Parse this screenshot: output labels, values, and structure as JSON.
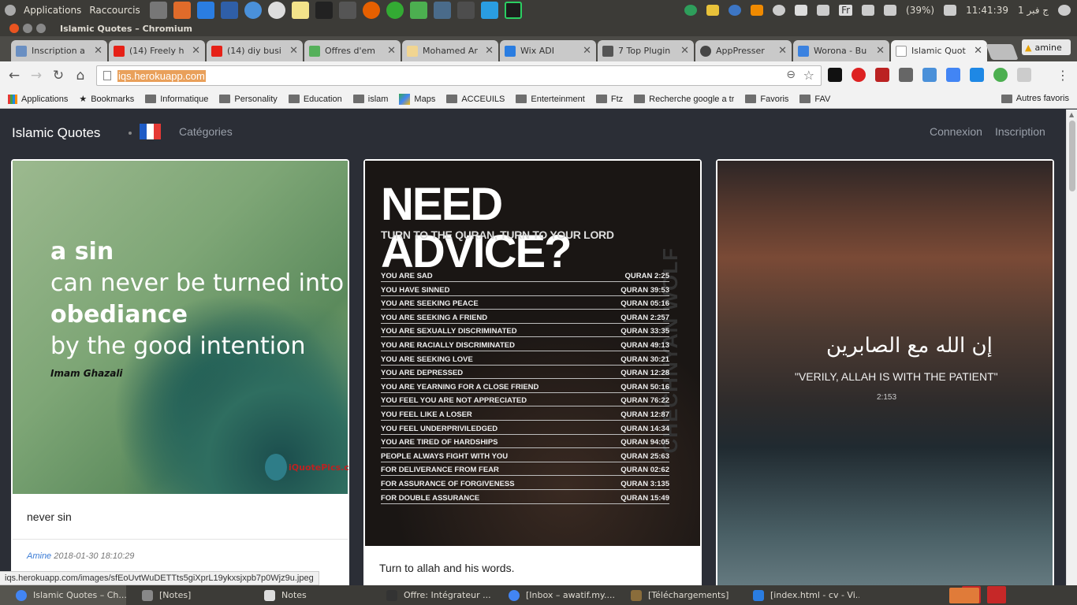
{
  "system_bar": {
    "menu_applications": "Applications",
    "menu_shortcuts": "Raccourcis",
    "battery": "(39%)",
    "clock": "11:41:39",
    "date_arabic": "ج فبر 1",
    "keyboard_layout": "Fr"
  },
  "window": {
    "title": "Islamic Quotes – Chromium"
  },
  "tabs": [
    {
      "label": "Inscription a",
      "fav_color": "#6a8fc2"
    },
    {
      "label": "(14) Freely h",
      "fav_color": "#e62117"
    },
    {
      "label": "(14) diy busi",
      "fav_color": "#e62117"
    },
    {
      "label": "Offres d'em",
      "fav_color": "#55b05a"
    },
    {
      "label": "Mohamed Ar",
      "fav_color": "#f1d591"
    },
    {
      "label": "Wix ADI",
      "fav_color": "#2a7de1"
    },
    {
      "label": "7 Top Plugin",
      "fav_color": "#555555"
    },
    {
      "label": "AppPresser",
      "fav_color": "#464646"
    },
    {
      "label": "Worona - Bu",
      "fav_color": "#3b82e0"
    },
    {
      "label": "Islamic Quot",
      "fav_color": "#ffffff",
      "active": true
    }
  ],
  "profile": {
    "name": "amine"
  },
  "address": {
    "url": "iqs.herokuapp.com"
  },
  "bookmarks": [
    {
      "label": "Applications",
      "icon": "apps-grid-icon"
    },
    {
      "label": "Bookmarks",
      "icon": "star-icon"
    },
    {
      "label": "Informatique",
      "icon": "folder-icon"
    },
    {
      "label": "Personality",
      "icon": "folder-icon"
    },
    {
      "label": "Education",
      "icon": "folder-icon"
    },
    {
      "label": "islam",
      "icon": "folder-icon"
    },
    {
      "label": "Maps",
      "icon": "maps-icon"
    },
    {
      "label": "ACCEUILS",
      "icon": "folder-icon"
    },
    {
      "label": "Enterteinment",
      "icon": "folder-icon"
    },
    {
      "label": "Ftz",
      "icon": "folder-icon"
    },
    {
      "label": "Recherche google a tr",
      "icon": "folder-icon"
    },
    {
      "label": "Favoris",
      "icon": "folder-icon"
    },
    {
      "label": "FAV",
      "icon": "folder-icon"
    }
  ],
  "bookmarks_other": "Autres favoris",
  "site": {
    "brand": "Islamic Quotes",
    "categories": "Catégories",
    "login": "Connexion",
    "signup": "Inscription"
  },
  "cards": [
    {
      "image_quote": {
        "line1": "a sin",
        "line2": "can never be turned into",
        "line3": "obediance",
        "line4": "by the good intention",
        "author": "Imam Ghazali",
        "watermark": "iQuotePics.com"
      },
      "title": "never sin",
      "meta_user": "Amine",
      "meta_date": "2018-01-30 18:10:29"
    },
    {
      "image_quote": {
        "heading": "NEED ADVICE?",
        "subheading": "TURN TO THE QURAN, TURN TO YOUR LORD",
        "side_text": "CHECHNYAN WOLF",
        "rows": [
          {
            "left": "YOU ARE SAD",
            "right": "QURAN 2:25"
          },
          {
            "left": "YOU HAVE SINNED",
            "right": "QURAN 39:53"
          },
          {
            "left": "YOU ARE SEEKING PEACE",
            "right": "QURAN 05:16"
          },
          {
            "left": "YOU ARE SEEKING A FRIEND",
            "right": "QURAN 2:257"
          },
          {
            "left": "YOU ARE SEXUALLY DISCRIMINATED",
            "right": "QURAN 33:35"
          },
          {
            "left": "YOU ARE RACIALLY DISCRIMINATED",
            "right": "QURAN 49:13"
          },
          {
            "left": "YOU ARE SEEKING LOVE",
            "right": "QURAN 30:21"
          },
          {
            "left": "YOU ARE DEPRESSED",
            "right": "QURAN 12:28"
          },
          {
            "left": "YOU ARE YEARNING FOR A CLOSE FRIEND",
            "right": "QURAN 50:16"
          },
          {
            "left": "YOU FEEL YOU ARE NOT APPRECIATED",
            "right": "QURAN 76:22"
          },
          {
            "left": "YOU FEEL LIKE A LOSER",
            "right": "QURAN 12:87"
          },
          {
            "left": "YOU FEEL UNDERPRIVILEDGED",
            "right": "QURAN 14:34"
          },
          {
            "left": "YOU ARE TIRED OF HARDSHIPS",
            "right": "QURAN 94:05"
          },
          {
            "left": "PEOPLE ALWAYS FIGHT WITH YOU",
            "right": "QURAN 25:63"
          },
          {
            "left": "FOR DELIVERANCE FROM FEAR",
            "right": "QURAN 02:62"
          },
          {
            "left": "FOR ASSURANCE OF FORGIVENESS",
            "right": "QURAN 3:135"
          },
          {
            "left": "FOR DOUBLE ASSURANCE",
            "right": "QURAN 15:49"
          }
        ]
      },
      "title": "Turn to allah and his words."
    },
    {
      "image_quote": {
        "arabic": "إن الله مع الصابرين",
        "text": "\"VERILY, ALLAH IS WITH THE PATIENT\"",
        "ref": "2:153"
      }
    }
  ],
  "status_url": "iqs.herokuapp.com/images/sfEoUvtWuDETTts5giXprL19ykxsjxpb7p0Wjz9u.jpeg",
  "taskbar": [
    {
      "label": "Islamic Quotes – Ch...",
      "icon_color": "#4285f4"
    },
    {
      "label": "[Notes]",
      "icon_color": "#888888"
    },
    {
      "label": "Notes",
      "icon_color": "#dddddd"
    },
    {
      "label": "Offre: Intégrateur ...",
      "icon_color": "#333333"
    },
    {
      "label": "[Inbox – awatif.my....",
      "icon_color": "#4285f4"
    },
    {
      "label": "[Téléchargements]",
      "icon_color": "#8a6d3b"
    },
    {
      "label": "[index.html - cv - Vi...",
      "icon_color": "#2a7de1"
    }
  ],
  "colors": {
    "page_bg": "#2b2e36",
    "accent_selection": "#e9a05a",
    "link": "#3a7bd5"
  }
}
